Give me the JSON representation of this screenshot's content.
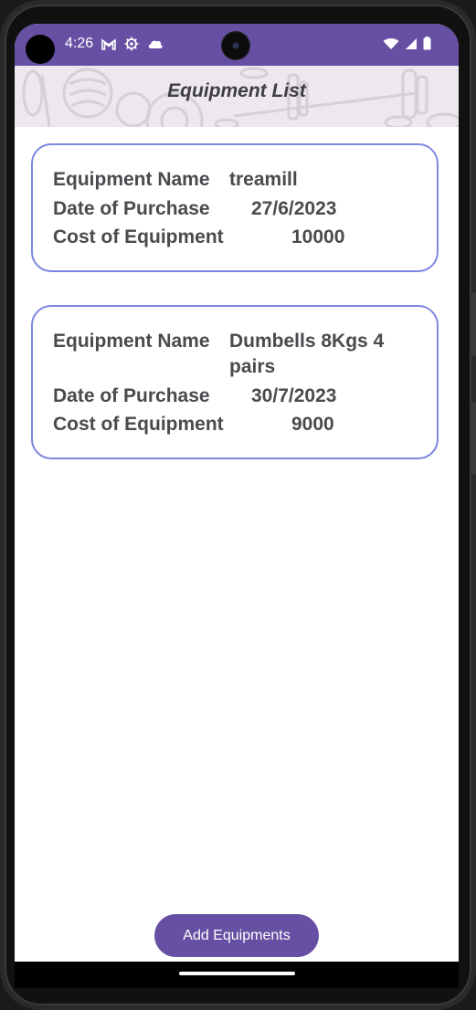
{
  "status_bar": {
    "time": "4:26",
    "icons": [
      "gmail-icon",
      "settings-icon",
      "cloud-icon",
      "wifi-icon",
      "signal-icon",
      "battery-icon"
    ],
    "background": "#6750a4"
  },
  "header": {
    "title": "Equipment List",
    "background": "#efe7ef"
  },
  "equipment": [
    {
      "name_label": "Equipment Name",
      "name": "treamill",
      "date_label": "Date of Purchase",
      "date": "27/6/2023",
      "cost_label": "Cost of Equipment",
      "cost": "10000"
    },
    {
      "name_label": "Equipment Name",
      "name": "Dumbells 8Kgs 4 pairs",
      "date_label": "Date of Purchase",
      "date": "30/7/2023",
      "cost_label": "Cost of Equipment",
      "cost": "9000"
    }
  ],
  "actions": {
    "add_label": "Add Equipments"
  },
  "colors": {
    "accent": "#6750a4",
    "card_border": "#7d86e0",
    "text": "#4a4a4f"
  }
}
